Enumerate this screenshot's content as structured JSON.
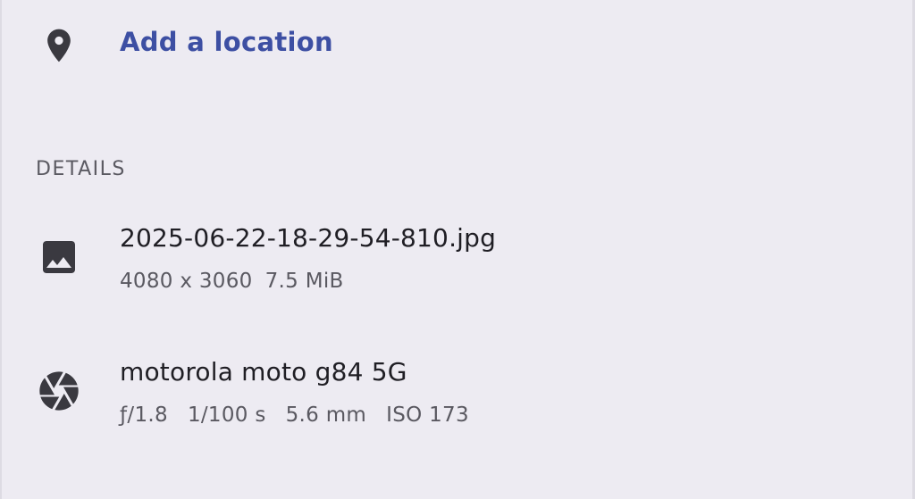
{
  "location": {
    "icon": "location-pin-icon",
    "label": "Add a location"
  },
  "details": {
    "header": "DETAILS",
    "file": {
      "icon": "image-icon",
      "name": "2025-06-22-18-29-54-810.jpg",
      "resolution": "4080 x 3060",
      "size": "7.5 MiB"
    },
    "camera": {
      "icon": "camera-aperture-icon",
      "model": "motorola moto g84 5G",
      "aperture": "ƒ/1.8",
      "shutter": "1/100 s",
      "focal_length": "5.6 mm",
      "iso": "ISO 173"
    }
  },
  "colors": {
    "background": "#edebf2",
    "accent": "#3d4fa3",
    "icon": "#3a3940"
  }
}
